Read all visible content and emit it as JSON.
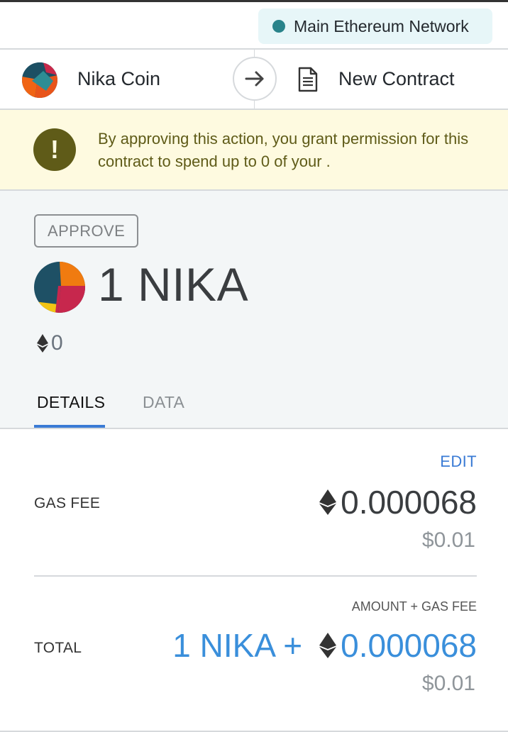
{
  "network": {
    "label": "Main Ethereum Network",
    "dot_color": "#29838a"
  },
  "transfer": {
    "from_name": "Nika Coin",
    "to_name": "New Contract",
    "arrow_icon": "arrow-right-icon",
    "contract_icon": "document-icon"
  },
  "warning": {
    "icon": "!",
    "text": "By approving this action, you grant permission for this contract to spend up to 0 of your ."
  },
  "summary": {
    "action": "APPROVE",
    "token_amount": "1 NIKA",
    "eth_value": "0"
  },
  "tabs": [
    {
      "label": "DETAILS",
      "active": true
    },
    {
      "label": "DATA",
      "active": false
    }
  ],
  "details": {
    "edit_label": "EDIT",
    "gas_fee_label": "GAS FEE",
    "gas_fee_eth": "0.000068",
    "gas_fee_fiat": "$0.01",
    "amount_plus_gas_label": "AMOUNT + GAS FEE",
    "total_label": "TOTAL",
    "total_token": "1 NIKA +",
    "total_eth": "0.000068",
    "total_fiat": "$0.01"
  },
  "colors": {
    "accent": "#3a7bd5",
    "total_blue": "#3a8fdb",
    "warning_bg": "#fefae0",
    "warning_fg": "#5f5b18"
  }
}
